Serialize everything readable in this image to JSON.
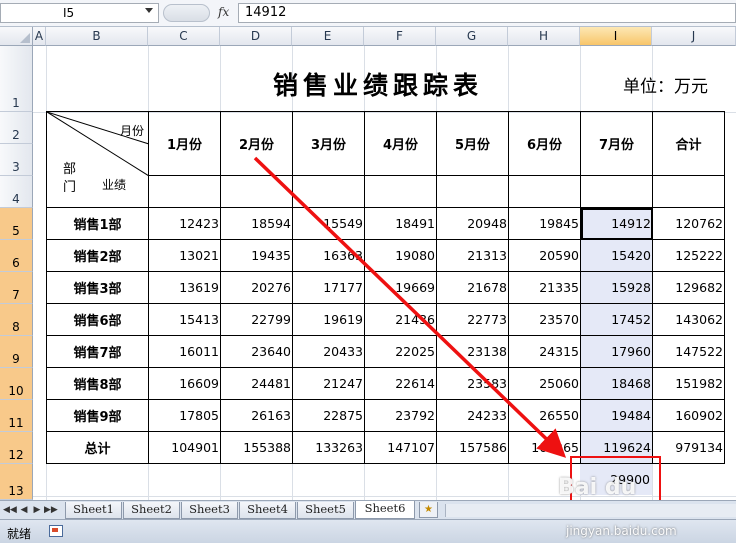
{
  "formula_bar": {
    "name_box": "I5",
    "fx_label": "fx",
    "formula": "14912"
  },
  "columns": [
    "A",
    "B",
    "C",
    "D",
    "E",
    "F",
    "G",
    "H",
    "I",
    "J"
  ],
  "rows": [
    "1",
    "2",
    "3",
    "4",
    "5",
    "6",
    "7",
    "8",
    "9",
    "10",
    "11",
    "12",
    "13"
  ],
  "sheet": {
    "title": "销售业绩跟踪表",
    "unit": "单位：万元",
    "diag_labels": {
      "month": "月份",
      "dept_top": "部",
      "dept_bottom": "门",
      "performance": "业绩"
    },
    "headers": [
      "1月份",
      "2月份",
      "3月份",
      "4月份",
      "5月份",
      "6月份",
      "7月份",
      "合计"
    ],
    "data_rows": [
      {
        "dept": "销售1部",
        "values": [
          "12423",
          "18594",
          "15549",
          "18491",
          "20948",
          "19845",
          "14912",
          "120762"
        ]
      },
      {
        "dept": "销售2部",
        "values": [
          "13021",
          "19435",
          "16363",
          "19080",
          "21313",
          "20590",
          "15420",
          "125222"
        ]
      },
      {
        "dept": "销售3部",
        "values": [
          "13619",
          "20276",
          "17177",
          "19669",
          "21678",
          "21335",
          "15928",
          "129682"
        ]
      },
      {
        "dept": "销售6部",
        "values": [
          "15413",
          "22799",
          "19619",
          "21436",
          "22773",
          "23570",
          "17452",
          "143062"
        ]
      },
      {
        "dept": "销售7部",
        "values": [
          "16011",
          "23640",
          "20433",
          "22025",
          "23138",
          "24315",
          "17960",
          "147522"
        ]
      },
      {
        "dept": "销售8部",
        "values": [
          "16609",
          "24481",
          "21247",
          "22614",
          "23583",
          "25060",
          "18468",
          "151982"
        ]
      },
      {
        "dept": "销售9部",
        "values": [
          "17805",
          "26163",
          "22875",
          "23792",
          "24233",
          "26550",
          "19484",
          "160902"
        ]
      }
    ],
    "total_row": {
      "dept": "总计",
      "values": [
        "104901",
        "155388",
        "133263",
        "147107",
        "157586",
        "161265",
        "119624",
        "979134"
      ]
    },
    "extra_value": "29900"
  },
  "sheet_tabs": [
    "Sheet1",
    "Sheet2",
    "Sheet3",
    "Sheet4",
    "Sheet5",
    "Sheet6"
  ],
  "active_tab": "Sheet6",
  "status": {
    "text": "就绪"
  },
  "watermark": {
    "logo": "Bai du",
    "url": "jingyan.baidu.com"
  },
  "colors": {
    "highlight_column": "#e5e9f7",
    "selected_header": "#f8c56a",
    "annotation_red": "#ee1111"
  }
}
